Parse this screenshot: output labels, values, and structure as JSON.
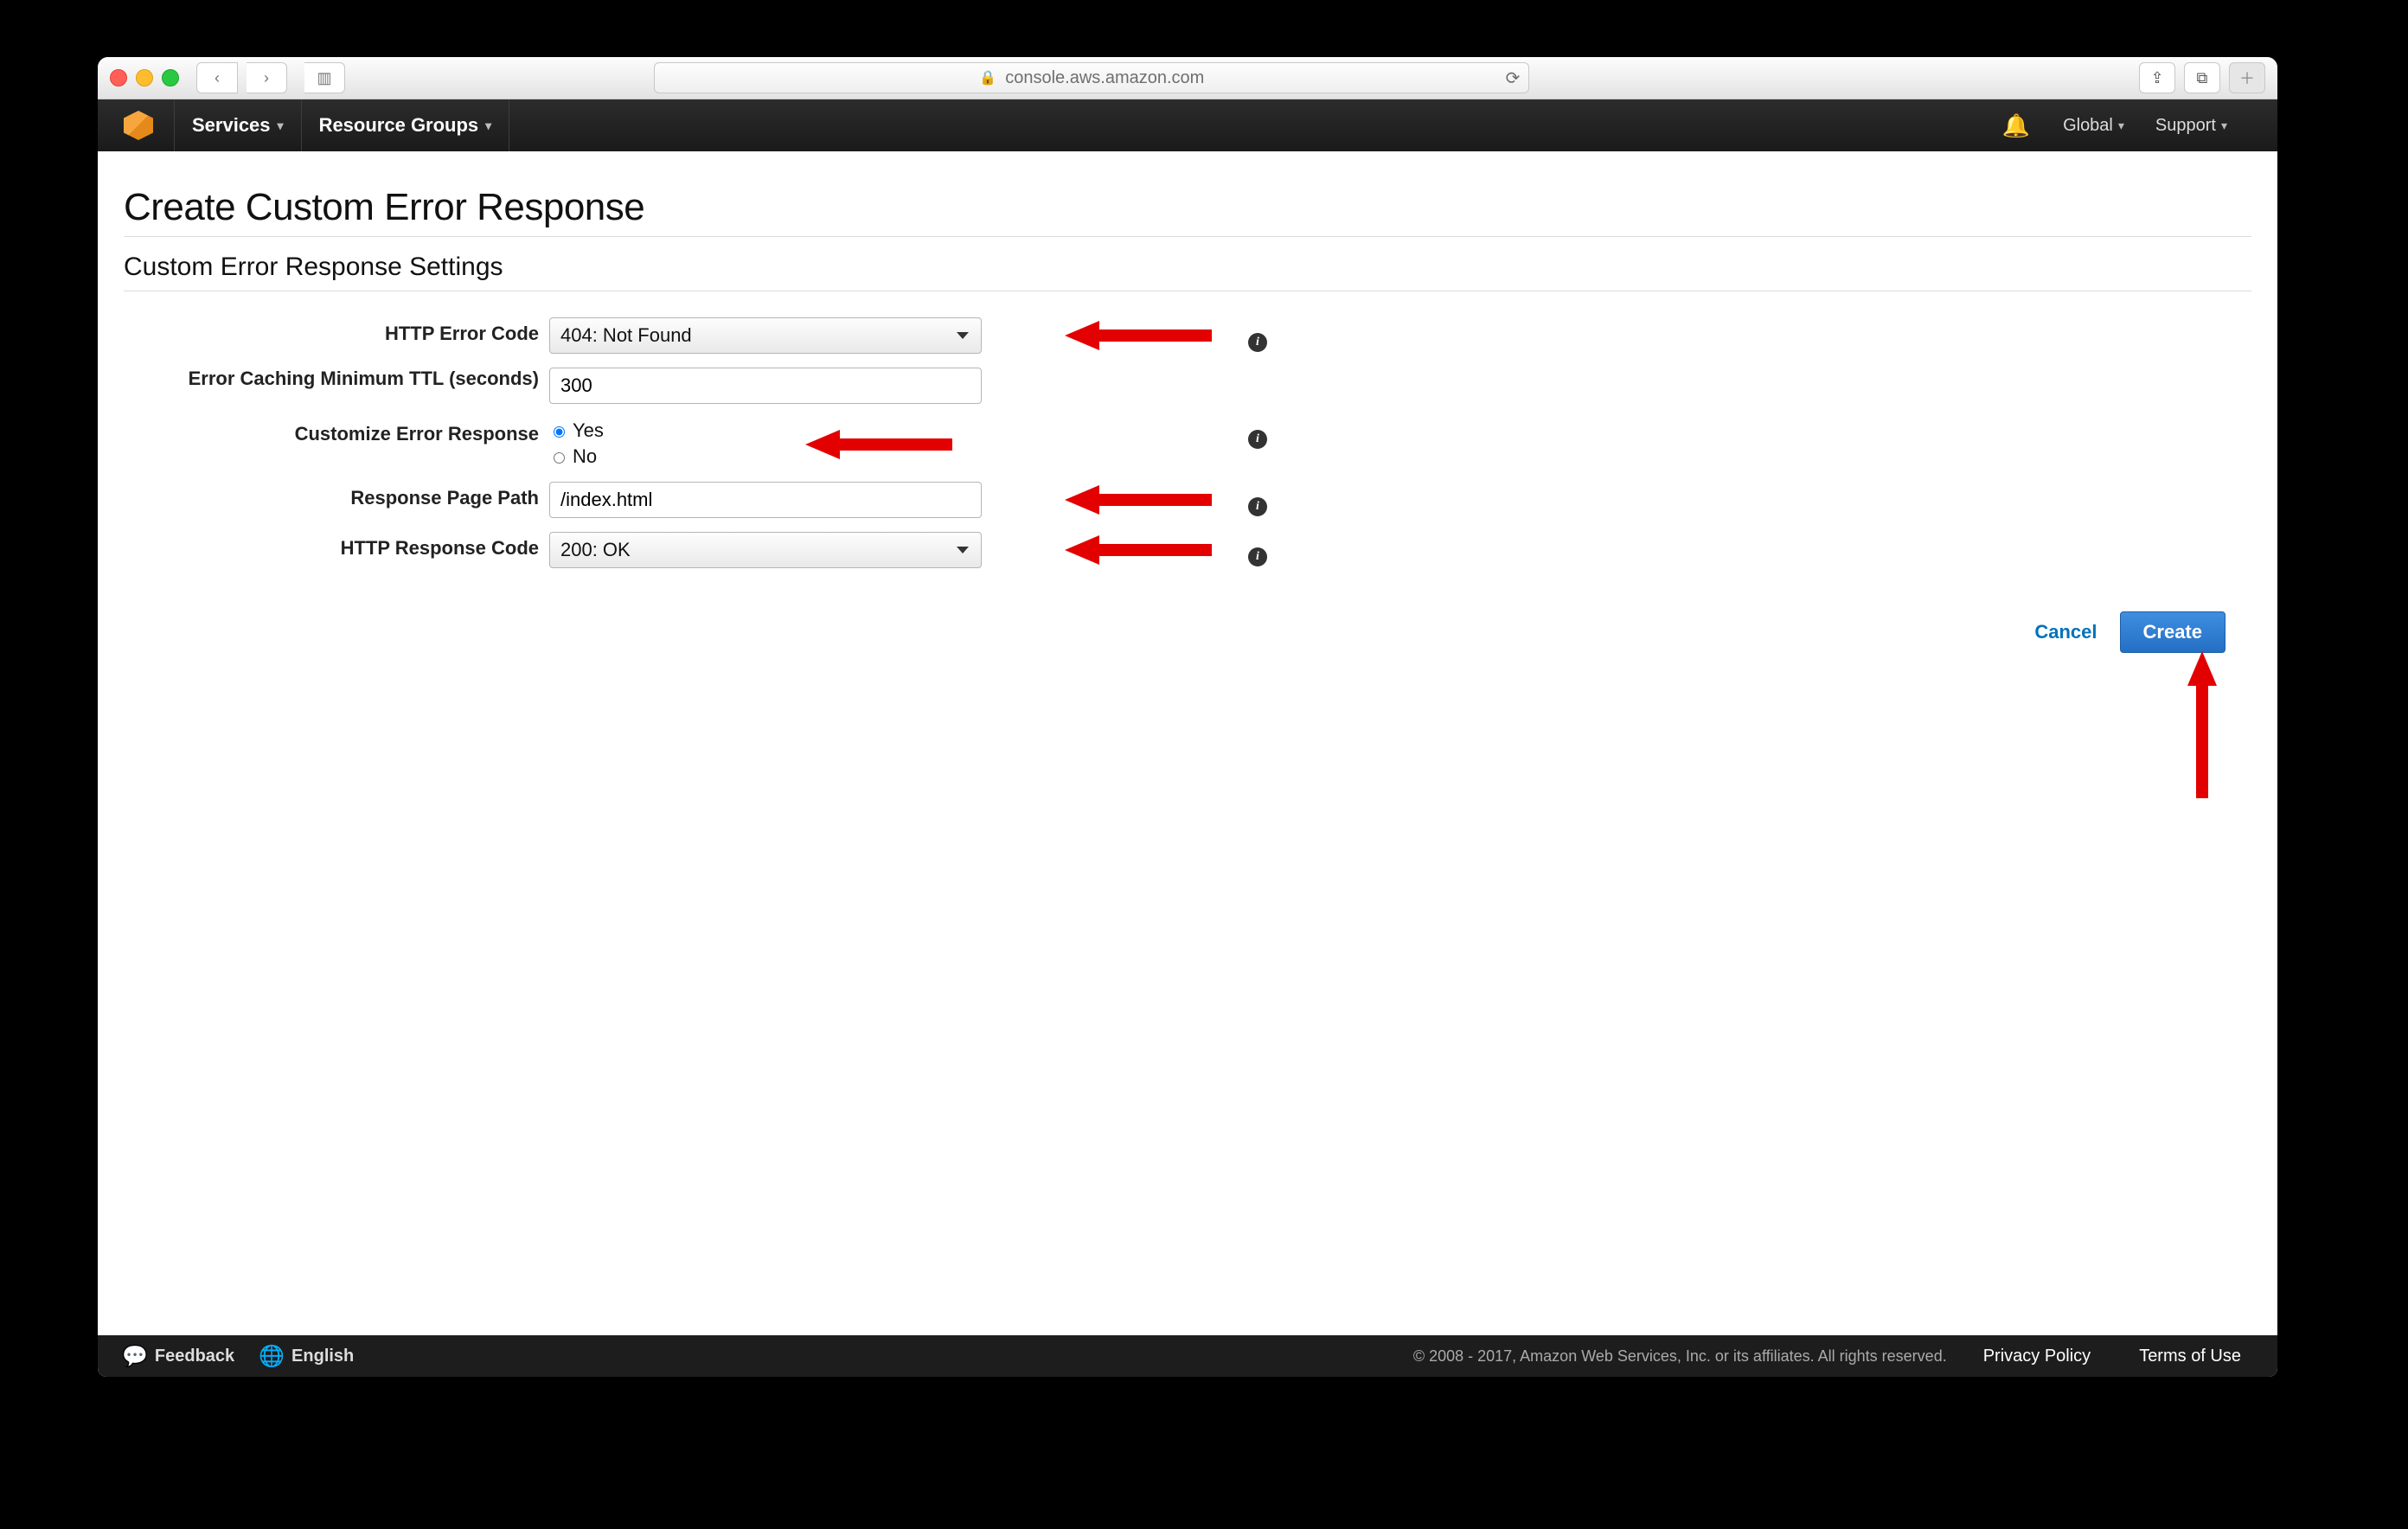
{
  "browser": {
    "url_host": "console.aws.amazon.com"
  },
  "nav": {
    "services": "Services",
    "resource_groups": "Resource Groups",
    "region": "Global",
    "support": "Support"
  },
  "page": {
    "title": "Create Custom Error Response",
    "section_title": "Custom Error Response Settings"
  },
  "form": {
    "http_error_code": {
      "label": "HTTP Error Code",
      "value": "404: Not Found"
    },
    "ttl": {
      "label": "Error Caching Minimum TTL (seconds)",
      "value": "300"
    },
    "customize": {
      "label": "Customize Error Response",
      "yes": "Yes",
      "no": "No",
      "selected": "yes"
    },
    "page_path": {
      "label": "Response Page Path",
      "value": "/index.html"
    },
    "response_code": {
      "label": "HTTP Response Code",
      "value": "200: OK"
    }
  },
  "actions": {
    "cancel": "Cancel",
    "create": "Create"
  },
  "footer": {
    "feedback": "Feedback",
    "language": "English",
    "copyright": "© 2008 - 2017, Amazon Web Services, Inc. or its affiliates. All rights reserved.",
    "privacy": "Privacy Policy",
    "terms": "Terms of Use"
  }
}
